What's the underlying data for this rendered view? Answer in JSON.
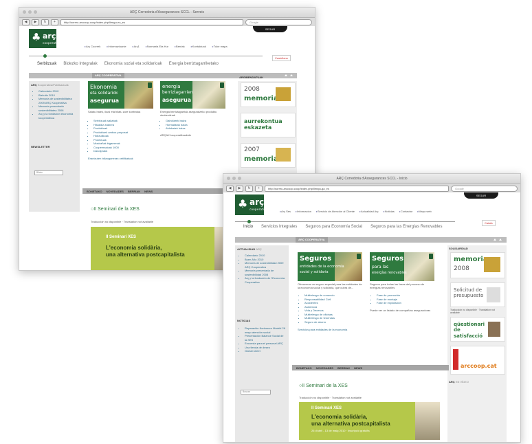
{
  "back": {
    "title": "ARÇ Corredoria d'Assegurances SCCL - Serveis",
    "url": "http://sorreu.arccoop.coop/index.php/llengu-eu_es",
    "search_placeholder": "Google",
    "logo": {
      "name": "arç",
      "sub": "cooperativa"
    },
    "pill": "SEGUR",
    "top_nav": [
      "Arç Coorrek",
      "Informazioanie",
      "Arç1",
      "Normaria Eta Hur",
      "Berriak",
      "Kontaktuak",
      "Tuke mapa"
    ],
    "main_nav": [
      "Serbitzuak",
      "Bidezko Integralak",
      "Ekonomia sozial eta solidarioak",
      "Energia berriztagarriketako"
    ],
    "lang": "Castellano",
    "bar_label": "ARÇ",
    "bar_sub": "COOPERATIVA",
    "sidebar_label": "ARÇ",
    "sidebar_label_sub": "Kooperativa/Publikazioak",
    "sidebar_links": [
      "Calendario 2010",
      "Bizkuits 2010",
      "Memoria de sostenibilitatea 2009 ARÇ Kooperativa",
      "Memoria presentada sostenibilitatea 2008",
      "Arç y la fundación ekonomia kooperatiboa"
    ],
    "newsletter": "NEWSLETTER",
    "search_label": "Bilatu",
    "card1": {
      "line1": "Ekonomia",
      "line2": "eta solidariok",
      "line3": "asegurua",
      "desc": "Saiatu haiek, ikusi eta bilatu zure kontratua",
      "links": [
        "Serbitzuak sakabak",
        "Hitzaldiz arabera",
        "Produktuak",
        "Produktuek ambos proposat",
        "Hidraulikoak",
        "Proiektuak",
        "Mostrañak bigarrenak",
        "Coopeerazioak 1000",
        "Dandiprakk"
      ]
    },
    "card2": {
      "line1": "energia",
      "line2": "berriztagarrien",
      "line3": "asegurua",
      "desc": "Energia berriztagarriak aseguratzeko produktu desberdinak",
      "links": [
        "Gaindiarek baiza",
        "Hormatarak baiza",
        "Aldebatek baiza"
      ],
      "note": "ARÇAK kooperatibazkide"
    },
    "more_link": "Erantzuten biliaoganeran cetifikatuak",
    "tabs": [
      "BONETAKO",
      "NOVEDADES",
      "BERRIAK",
      "NEWS"
    ],
    "event_title": "II Seminari de la XES",
    "translation_note": "Traducción no disponible · Translation not available",
    "ev_line1": "II Seminari XES",
    "ev_line2": "L'economia solidària,",
    "ev_line3": "una alternativa postcapitalista",
    "right_label": "ARGIBENDATUAK",
    "ads": [
      {
        "year": "2008",
        "text": "memoria"
      },
      {
        "year": "",
        "text": "aurrekontua eskazeta"
      },
      {
        "year": "2007",
        "text": "memoria"
      }
    ]
  },
  "front": {
    "title": "ARÇ Corredoria d'Assegurances SCCL - Inicio",
    "url": "http://sorreu.arccoop.coop/index.php/llengu-ga_es",
    "search_placeholder": "Google",
    "logo": {
      "name": "arç",
      "sub": "cooperativa"
    },
    "pill": "SEGUR",
    "top_nav": [
      "Arç Ses",
      "Informacion",
      "Servicio de Atención al Cliente",
      "Actualidad Arç",
      "Noticias",
      "Contactar",
      "Mapa web"
    ],
    "main_nav": [
      "Inicio",
      "Servicios Integrales",
      "Seguros para Economía Social",
      "Seguros para las Energías Renovables"
    ],
    "lang": "Català",
    "bar_label": "ARÇ",
    "bar_sub": "COOPERATIVA",
    "sidebar_label": "ACTUALIDAD",
    "sidebar_label_sub": "ARÇ",
    "sidebar_links": [
      "Calendario 2010",
      "Buen Año 2010",
      "Memoria de sostenibilidad 2009 ARÇ Cooperativa",
      "Memoria presentada de sostenibilidad 2008",
      "Arç y la fundación de l'Economía Cooperativa"
    ],
    "noticias": "NOTICIAS",
    "noticias_links": [
      "Reparación fluviomuro Madrid 26 mayo atención social",
      "Presentación Balance Social de la XES",
      "Encuesta para el personal ARÇ",
      "Una tienda de deseo",
      "Global street"
    ],
    "search_label": "Buscar",
    "card1": {
      "line1": "Seguros",
      "line2": "entidades de la economía",
      "line3": "social y solidaria",
      "desc": "Ofrecemos un seguro especial para las entidades de la economía social y solidaria, que cubra de...",
      "links": [
        "Multirriesgo de comercio",
        "Responsabilidad Civil",
        "Accidentes",
        "Asistencia",
        "Vida y Decesos",
        "Multirriesgo de oficinas",
        "Multirriesgo de viviendas",
        "Seguro de ahorro"
      ]
    },
    "card2": {
      "line1": "Seguros",
      "line2": "para las",
      "line3": "energías renovables",
      "desc": "Seguros para todas las fases del proceso de energías renovables",
      "links": [
        "Fase de promoción",
        "Fase de montaje",
        "Fase de explotación"
      ],
      "note": "Puede ver un listado de compañías aseguradoras"
    },
    "more_link": "Servicios para entidades de la economía",
    "tabs": [
      "BONETAKO",
      "NOVEDADES",
      "BERRIAK",
      "NEWS"
    ],
    "event_title": "II Seminari de la XES",
    "translation_note": "Traducción no disponible · Translation not available",
    "ev_line1": "II Seminari XES",
    "ev_line2": "L'economia solidària,",
    "ev_line3": "una alternativa postcapitalista",
    "ev_line4": "26 d'abril - 13 de maig 2010 · Inscripció gratuïta",
    "right_label": "SOLIDARIDAD",
    "ads": [
      {
        "year": "2008",
        "text": "memoria"
      },
      {
        "year": "",
        "text": "Solicitud de presupuesto"
      },
      {
        "year": "",
        "text": "qüestionari de satisfacció"
      },
      {
        "year": "",
        "text": "arccoop.cat"
      }
    ],
    "ad_note": "Traducción no disponible · Translation not available",
    "arc_label": "ARÇ",
    "arc_sub": "EN VÍDEO"
  }
}
